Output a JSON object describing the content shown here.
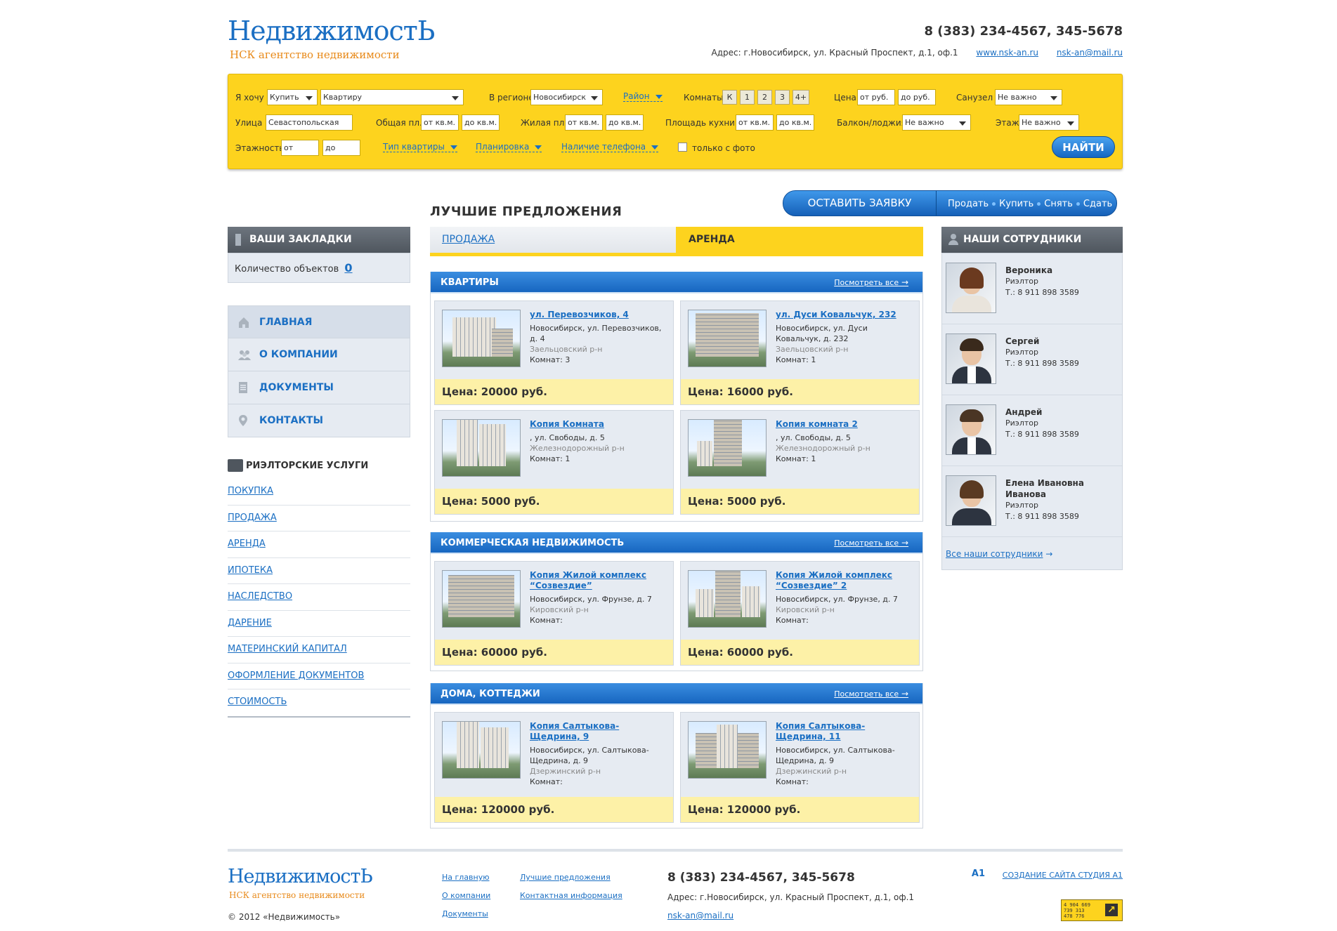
{
  "header": {
    "logo_title": "НедвижимостЬ",
    "logo_subtitle": "НСК агентство недвижимости",
    "phone": "8 (383) 234-4567, 345-5678",
    "address": "Адрес: г.Новосибирск, ул. Красный Проспект, д.1, оф.1",
    "site": "www.nsk-an.ru",
    "email": "nsk-an@mail.ru"
  },
  "search": {
    "want_label": "Я хочу",
    "want_value": "Купить",
    "type_value": "Квартиру",
    "region_label": "В регионе",
    "region_value": "Новосибирск",
    "district_label": "Район",
    "rooms_label": "Комнаты",
    "rooms": [
      "К",
      "1",
      "2",
      "3",
      "4+"
    ],
    "price_label": "Цена",
    "price_from": "от руб.",
    "price_to": "до руб.",
    "bath_label": "Санузел",
    "bath_value": "Не важно",
    "street_label": "Улица",
    "street_value": "Севастопольская",
    "total_area_label": "Общая пл.",
    "total_from": "от кв.м.",
    "total_to": "до кв.м.",
    "living_area_label": "Жилая пл.",
    "living_from": "от кв.м.",
    "living_to": "до кв.м.",
    "kitchen_label": "Площадь кухни",
    "kitchen_from": "от кв.м.",
    "kitchen_to": "до кв.м.",
    "balcony_label": "Балкон/лоджия",
    "balcony_value": "Не важно",
    "floor_label": "Этаж",
    "floor_value": "Не важно",
    "storeys_label": "Этажность",
    "storeys_from": "от",
    "storeys_to": "до",
    "apt_type_label": "Тип квартиры",
    "layout_label": "Планировка",
    "phone_label": "Наличие телефона",
    "photo_label": "только с фото",
    "find_button": "НАЙТИ"
  },
  "request": {
    "button": "ОСТАВИТЬ ЗАЯВКУ",
    "options": [
      "Продать",
      "Купить",
      "Снять",
      "Сдать"
    ]
  },
  "bookmarks": {
    "title": "ВАШИ ЗАКЛАДКИ",
    "count_label": "Количество объектов",
    "count": "0"
  },
  "nav": [
    {
      "label": "ГЛАВНАЯ",
      "icon": "home-icon"
    },
    {
      "label": "О КОМПАНИИ",
      "icon": "people-icon"
    },
    {
      "label": "ДОКУМЕНТЫ",
      "icon": "document-icon"
    },
    {
      "label": "КОНТАКТЫ",
      "icon": "location-pin-icon"
    }
  ],
  "services": {
    "title": "РИЭЛТОРСКИЕ УСЛУГИ",
    "items": [
      "ПОКУПКА",
      "ПРОДАЖА",
      "АРЕНДА",
      "ИПОТЕКА",
      "НАСЛЕДСТВО",
      "ДАРЕНИЕ",
      "МАТЕРИНСКИЙ КАПИТАЛ",
      "ОФОРМЛЕНИЕ ДОКУМЕНТОВ",
      "СТОИМОСТЬ"
    ]
  },
  "best": {
    "title": "ЛУЧШИЕ ПРЕДЛОЖЕНИЯ",
    "tab_sale": "ПРОДАЖА",
    "tab_rent": "АРЕНДА",
    "see_all": "Посмотреть все",
    "sections": [
      {
        "title": "КВАРТИРЫ",
        "cards": [
          {
            "title": "ул. Перевозчиков, 4",
            "addr": "Новосибирск, ул. Перевозчиков, д. 4",
            "district": "Заельцовский р-н",
            "rooms": "Комнат: 3",
            "price": "Цена: 20000 руб."
          },
          {
            "title": "ул. Дуси Ковальчук, 232",
            "addr": "Новосибирск, ул. Дуси Ковальчук, д. 232",
            "district": "Заельцовский р-н",
            "rooms": "Комнат: 1",
            "price": "Цена: 16000 руб."
          },
          {
            "title": "Копия Комната",
            "addr": ", ул. Свободы, д. 5",
            "district": "Железнодорожный р-н",
            "rooms": "Комнат: 1",
            "price": "Цена: 5000 руб."
          },
          {
            "title": "Копия комната 2",
            "addr": ", ул. Свободы, д. 5",
            "district": "Железнодорожный р-н",
            "rooms": "Комнат: 1",
            "price": "Цена: 5000 руб."
          }
        ]
      },
      {
        "title": "КОММЕРЧЕСКАЯ НЕДВИЖИМОСТЬ",
        "cards": [
          {
            "title": "Копия Жилой комплекс “Созвездие”",
            "addr": "Новосибирск, ул. Фрунзе, д. 7",
            "district": "Кировский р-н",
            "rooms": "Комнат:",
            "price": "Цена: 60000 руб."
          },
          {
            "title": "Копия Жилой комплекс “Созвездие” 2",
            "addr": "Новосибирск, ул. Фрунзе, д. 7",
            "district": "Кировский р-н",
            "rooms": "Комнат:",
            "price": "Цена: 60000 руб."
          }
        ]
      },
      {
        "title": "ДОМА, КОТТЕДЖИ",
        "cards": [
          {
            "title": "Копия Салтыкова-Щедрина, 9",
            "addr": "Новосибирск, ул. Салтыкова-Щедрина, д. 9",
            "district": "Дзержинский р-н",
            "rooms": "Комнат:",
            "price": "Цена: 120000 руб."
          },
          {
            "title": "Копия Салтыкова-Щедрина, 11",
            "addr": "Новосибирск, ул. Салтыкова-Щедрина, д. 9",
            "district": "Дзержинский р-н",
            "rooms": "Комнат:",
            "price": "Цена: 120000 руб."
          }
        ]
      }
    ]
  },
  "employees": {
    "title": "НАШИ СОТРУДНИКИ",
    "items": [
      {
        "name": "Вероника",
        "role": "Риэлтор",
        "phone": "Т.: 8 911 898 3589"
      },
      {
        "name": "Сергей",
        "role": "Риэлтор",
        "phone": "Т.: 8 911 898 3589"
      },
      {
        "name": "Андрей",
        "role": "Риэлтор",
        "phone": "Т.: 8 911 898 3589"
      },
      {
        "name": "Елена Ивановна Иванова",
        "role": "Риэлтор",
        "phone": "Т.: 8 911 898 3589"
      }
    ],
    "all_link": "Все наши сотрудники"
  },
  "footer": {
    "logo_title": "НедвижимостЬ",
    "logo_subtitle": "НСК агентство недвижимости",
    "copyright": "© 2012 «Недвижимость»",
    "links_col1": [
      "На главную",
      "О компании",
      "Документы"
    ],
    "links_col2": [
      "Лучшие предложения",
      "Контактная информация"
    ],
    "phone": "8 (383) 234-4567, 345-5678",
    "address": "Адрес: г.Новосибирск, ул. Красный Проспект, д.1, оф.1",
    "email": "nsk-an@mail.ru",
    "studio_icon": "A1",
    "studio": "СОЗДАНИЕ САЙТА СТУДИЯ А1",
    "counter_lines": [
      "4 904 669",
      "739 313",
      "478 776"
    ]
  },
  "colors": {
    "accent_blue": "#1b6fc3",
    "yellow": "#fdd31e",
    "logo_orange": "#e88a1a"
  }
}
